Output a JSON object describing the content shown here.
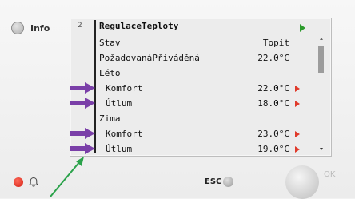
{
  "info_button": {
    "label": "Info",
    "icon": "round-key-icon"
  },
  "screen": {
    "page_number": "2",
    "title": "RegulaceTeploty",
    "title_icon": "play-icon",
    "rows": [
      {
        "label": "Stav",
        "value": "Topit"
      },
      {
        "label": "PožadovanáPřiváděná",
        "value": "22.0°C"
      },
      {
        "label": "Léto",
        "value": ""
      },
      {
        "label": "Komfort",
        "value": "22.0°C",
        "arrow": true,
        "marker": true
      },
      {
        "label": "Útlum",
        "value": "18.0°C",
        "arrow": true,
        "marker": true
      },
      {
        "label": "Zima",
        "value": ""
      },
      {
        "label": "Komfort",
        "value": "23.0°C",
        "arrow": true,
        "marker": true
      },
      {
        "label": "Útlum",
        "value": "19.0°C",
        "arrow": true,
        "marker": true
      }
    ]
  },
  "bottom": {
    "alarm_icon": "bell-icon",
    "esc_label": "ESC",
    "ok_label": "OK"
  },
  "colors": {
    "marker_purple": "#7a3fa8",
    "annotation_green": "#2aa24a",
    "row_arrow_red": "#e03a2a",
    "title_play_green": "#2c9b2c"
  }
}
